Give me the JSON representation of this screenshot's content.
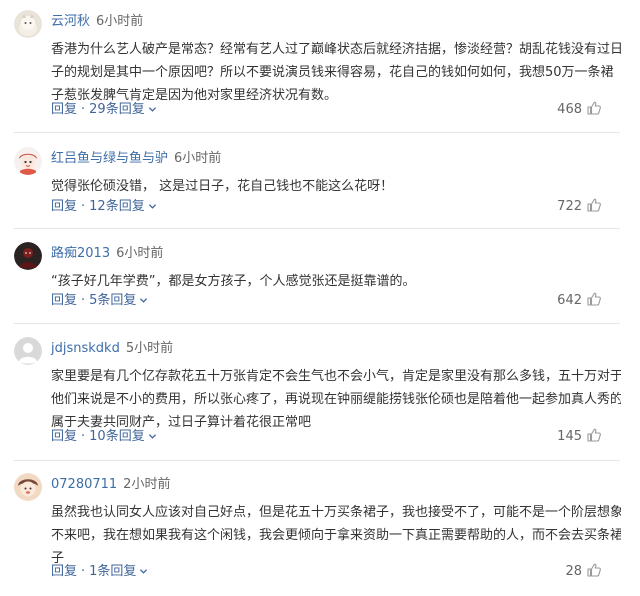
{
  "comments": [
    {
      "user": "云河秋",
      "time": "6小时前",
      "avatar_icon": "cat-avatar-icon",
      "lines": [
        "香港为什么艺人破产是常态？经常有艺人过了巅峰状态后就经济拮据，惨淡经营？胡乱花钱没有过日",
        "子的规划是其中一个原因吧？所以不要说演员钱来得容易，花自己的钱如何如何，我想50万一条裙",
        "子惹张发脾气肯定是因为他对家里经济状况有数。"
      ],
      "reply_label": "回复",
      "replies_label": "29条回复",
      "likes": "468"
    },
    {
      "user": "红吕鱼与绿与鱼与驴",
      "time": "6小时前",
      "avatar_icon": "doll-avatar-icon",
      "lines": [
        "觉得张伦硕没错， 这是过日子，花自己钱也不能这么花呀！"
      ],
      "reply_label": "回复",
      "replies_label": "12条回复",
      "likes": "722"
    },
    {
      "user": "路痴2013",
      "time": "6小时前",
      "avatar_icon": "dark-figure-avatar-icon",
      "lines": [
        "“孩子好几年学费”，都是女方孩子，个人感觉张还是挺靠谱的。"
      ],
      "reply_label": "回复",
      "replies_label": "5条回复",
      "likes": "642"
    },
    {
      "user": "jdjsnskdkd",
      "time": "5小时前",
      "avatar_icon": "default-user-avatar-icon",
      "lines": [
        "家里要是有几个亿存款花五十万张肯定不会生气也不会小气，肯定是家里没有那么多钱，五十万对于",
        "他们来说是不小的费用，所以张心疼了，再说现在钟丽缇能捞钱张伦硕也是陪着他一起参加真人秀的",
        "属于夫妻共同财产，过日子算计着花很正常吧"
      ],
      "reply_label": "回复",
      "replies_label": "10条回复",
      "likes": "145"
    },
    {
      "user": "07280711",
      "time": "2小时前",
      "avatar_icon": "cartoon-face-avatar-icon",
      "lines": [
        "虽然我也认同女人应该对自己好点，但是花五十万买条裙子，我也接受不了，可能不是一个阶层想象",
        "不来吧，我在想如果我有这个闲钱，我会更倾向于拿来资助一下真正需要帮助的人，而不会去买条裙",
        "子"
      ],
      "reply_label": "回复",
      "replies_label": "1条回复",
      "likes": "28"
    }
  ],
  "colors": {
    "username": "#3d6ea8",
    "link": "#406599",
    "text": "#333333",
    "meta": "#666666",
    "divider": "#e6e6e6"
  }
}
